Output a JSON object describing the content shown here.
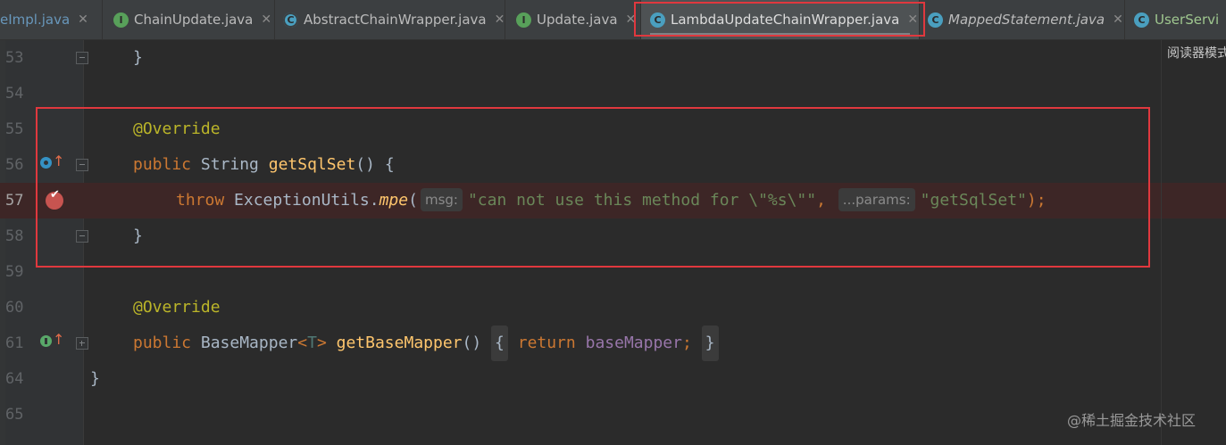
{
  "tabs": [
    {
      "name": "eImpl.java",
      "icon": "class-icon",
      "style": "blue"
    },
    {
      "name": "ChainUpdate.java",
      "icon": "interface-icon"
    },
    {
      "name": "AbstractChainWrapper.java",
      "icon": "abstract-class-icon"
    },
    {
      "name": "Update.java",
      "icon": "interface-icon"
    },
    {
      "name": "LambdaUpdateChainWrapper.java",
      "icon": "class-icon",
      "active": true
    },
    {
      "name": "MappedStatement.java",
      "icon": "class-icon",
      "style": "italic"
    },
    {
      "name": "UserServi",
      "icon": "class-icon",
      "style": "green"
    }
  ],
  "reader_mode_label": "阅读器模式",
  "watermark": "@稀土掘金技术社区",
  "lines": [
    {
      "num": "53",
      "brace": "}"
    },
    {
      "num": "54"
    },
    {
      "num": "55",
      "annotation": "@Override"
    },
    {
      "num": "56",
      "kw_public": "public",
      "type": "String",
      "method": "getSqlSet",
      "parens": "()",
      "brace": "{"
    },
    {
      "num": "57",
      "kw_throw": "throw",
      "cls": "ExceptionUtils",
      "dot": ".",
      "method": "mpe",
      "open": "(",
      "hint1": "msg:",
      "str1": "\"can not use this method for \\\"%s\\\"\"",
      "comma": ",",
      "hint2": "...params:",
      "str2": "\"getSqlSet\"",
      "close": ");"
    },
    {
      "num": "58",
      "brace": "}"
    },
    {
      "num": "59"
    },
    {
      "num": "60",
      "annotation": "@Override"
    },
    {
      "num": "61",
      "kw_public": "public",
      "type": "BaseMapper",
      "lt": "<",
      "generic": "T",
      "gt": ">",
      "method": "getBaseMapper",
      "parens": "()",
      "open_brace": "{",
      "kw_return": "return",
      "field": "baseMapper",
      "semi": ";",
      "close_brace": "}"
    },
    {
      "num": "64",
      "brace": "}"
    },
    {
      "num": "65"
    }
  ],
  "colors": {
    "highlight_border": "#e0383e",
    "keyword": "#cc7832",
    "annotation": "#bbb529",
    "method": "#ffc66d",
    "string": "#6a8759",
    "field": "#9876aa"
  }
}
